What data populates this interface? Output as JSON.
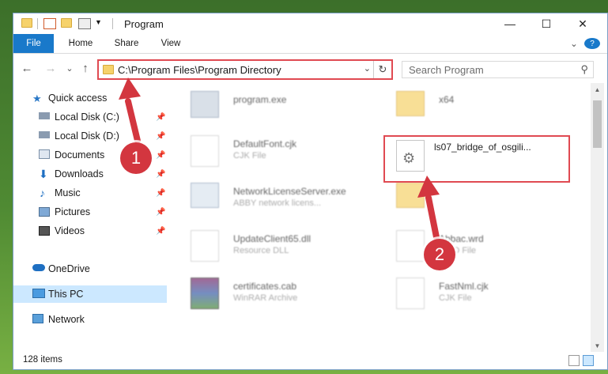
{
  "window": {
    "title": "Program",
    "minimize_glyph": "—",
    "maximize_glyph": "☐",
    "close_glyph": "✕"
  },
  "ribbon": {
    "tabs": [
      "File",
      "Home",
      "Share",
      "View"
    ],
    "expand_glyph": "⌄",
    "help_glyph": "?"
  },
  "address": {
    "path": "C:\\Program Files\\Program Directory",
    "back": "←",
    "forward": "→",
    "recent": "⌄",
    "up": "↑",
    "refresh": "↻",
    "dropdown": "⌄"
  },
  "search": {
    "placeholder": "Search Program",
    "icon": "search-icon"
  },
  "sidebar": {
    "items": [
      {
        "label": "Quick access",
        "icon": "star-icon",
        "pinned": false
      },
      {
        "label": "Local Disk (C:)",
        "icon": "drive-icon",
        "pinned": true
      },
      {
        "label": "Local Disk (D:)",
        "icon": "drive-icon",
        "pinned": true
      },
      {
        "label": "Documents",
        "icon": "documents-icon",
        "pinned": true
      },
      {
        "label": "Downloads",
        "icon": "download-icon",
        "pinned": true
      },
      {
        "label": "Music",
        "icon": "music-icon",
        "pinned": true
      },
      {
        "label": "Pictures",
        "icon": "pictures-icon",
        "pinned": true
      },
      {
        "label": "Videos",
        "icon": "videos-icon",
        "pinned": true
      },
      {
        "label": "OneDrive",
        "icon": "cloud-icon",
        "pinned": false
      },
      {
        "label": "This PC",
        "icon": "computer-icon",
        "pinned": false,
        "selected": true
      },
      {
        "label": "Network",
        "icon": "network-icon",
        "pinned": false
      }
    ],
    "pin_glyph": "📌"
  },
  "files": {
    "left": [
      {
        "name": "program.exe",
        "type": "",
        "icon": "exe-icon"
      },
      {
        "name": "DefaultFont.cjk",
        "type": "CJK File",
        "icon": "file-icon"
      },
      {
        "name": "NetworkLicenseServer.exe",
        "type": "ABBY network licens...",
        "icon": "exe-icon"
      },
      {
        "name": "UpdateClient65.dll",
        "type": "Resource DLL",
        "icon": "dll-icon"
      },
      {
        "name": "certificates.cab",
        "type": "WinRAR Archive",
        "icon": "archive-icon"
      }
    ],
    "right": [
      {
        "name": "x64",
        "type": "",
        "icon": "folder-icon"
      },
      {
        "name": "ls07_bridge_of_osgili...",
        "type": "",
        "icon": "settings-file-icon",
        "highlighted": true
      },
      {
        "name": "",
        "type": "",
        "icon": "folder-icon"
      },
      {
        "name": "Abbac.wrd",
        "type": "WRD File",
        "icon": "file-icon"
      },
      {
        "name": "FastNml.cjk",
        "type": "CJK File",
        "icon": "file-icon"
      }
    ]
  },
  "annotations": {
    "badge1": "1",
    "badge2": "2"
  },
  "status": {
    "count": "128 items"
  },
  "colors": {
    "accent": "#1979ca",
    "highlight": "#e04a52",
    "selection": "#cce8ff"
  }
}
